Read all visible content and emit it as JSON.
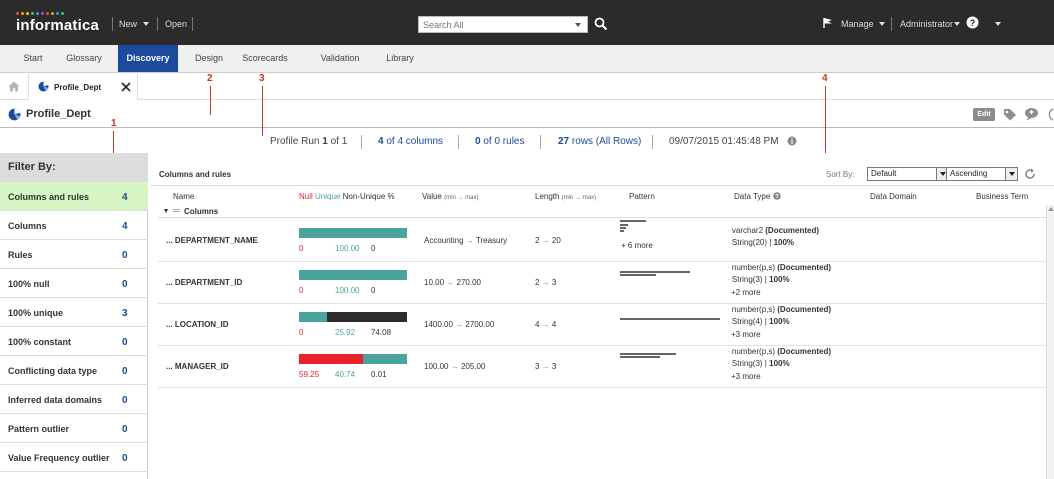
{
  "app": {
    "logo": "informatica",
    "logo_colors": [
      "#e74c3c",
      "#f39c12",
      "#f1c40f",
      "#2ecc71",
      "#3498db",
      "#9b59b6",
      "#e74c3c",
      "#f39c12",
      "#3498db",
      "#2ecc71"
    ],
    "menu_new": "New",
    "menu_open": "Open",
    "search_placeholder": "Search All",
    "manage": "Manage",
    "user": "Administrator"
  },
  "tabs": [
    {
      "label": "Start"
    },
    {
      "label": "Glossary"
    },
    {
      "label": "Discovery",
      "active": true
    },
    {
      "label": "Design"
    },
    {
      "label": "Scorecards"
    },
    {
      "label": "Validation"
    },
    {
      "label": "Library"
    }
  ],
  "doc_tab": {
    "label": "Profile_Dept"
  },
  "title": {
    "text": "Profile_Dept",
    "edit_label": "Edit"
  },
  "summary": {
    "run_prefix": "Profile Run",
    "run_num": "1",
    "run_suffix": "of 1",
    "cols_num": "4",
    "cols_suffix": "of 4 columns",
    "rules_num": "0",
    "rules_suffix": "of 0 rules",
    "rows_num": "27",
    "rows_suffix": "rows (All Rows)",
    "datetime": "09/07/2015 01:45:48 PM"
  },
  "annotations": [
    "1",
    "2",
    "3",
    "4"
  ],
  "filter": {
    "heading": "Filter By:",
    "items": [
      {
        "label": "Columns and rules",
        "count": "4",
        "active": true
      },
      {
        "label": "Columns",
        "count": "4"
      },
      {
        "label": "Rules",
        "count": "0"
      },
      {
        "label": "100% null",
        "count": "0"
      },
      {
        "label": "100% unique",
        "count": "3"
      },
      {
        "label": "100% constant",
        "count": "0"
      },
      {
        "label": "Conflicting data type",
        "count": "0"
      },
      {
        "label": "Inferred data domains",
        "count": "0"
      },
      {
        "label": "Pattern outlier",
        "count": "0"
      },
      {
        "label": "Value Frequency outlier",
        "count": "0"
      }
    ]
  },
  "main": {
    "heading": "Columns and rules",
    "sort_by_label": "Sort By:",
    "sort_value": "Default",
    "order_value": "Ascending",
    "headers": {
      "name": "Name",
      "null": "Null",
      "unique": "Unique",
      "nonunique": "Non-Unique %",
      "value": "Value",
      "value_range": "(min → max)",
      "length": "Length",
      "length_range": "(min → max)",
      "pattern": "Pattern",
      "datatype": "Data Type",
      "domain": "Data Domain",
      "term": "Business Term"
    },
    "group_label": "Columns",
    "rows": [
      {
        "name": "... DEPARTMENT_NAME",
        "null_pct": 0,
        "unique_pct": 100,
        "nonunique_pct": 0,
        "null_label": "0",
        "unique_label": "100.00",
        "nonunique_label": "0",
        "value_min": "Accounting",
        "value_max": "Treasury",
        "len_min": "2",
        "len_max": "20",
        "pattern_more": "+ 6 more",
        "dt1": "varchar2",
        "dt1_tag": "(Documented)",
        "dt2": "String(20) |",
        "dt2_pct": "100%",
        "dt_more": ""
      },
      {
        "name": "... DEPARTMENT_ID",
        "null_pct": 0,
        "unique_pct": 100,
        "nonunique_pct": 0,
        "null_label": "0",
        "unique_label": "100.00",
        "nonunique_label": "0",
        "value_min": "10.00",
        "value_max": "270.00",
        "len_min": "2",
        "len_max": "3",
        "pattern_more": "",
        "dt1": "number(p,s)",
        "dt1_tag": "(Documented)",
        "dt2": "String(3) |",
        "dt2_pct": "100%",
        "dt_more": "+2 more"
      },
      {
        "name": "... LOCATION_ID",
        "null_pct": 0,
        "unique_pct": 25.92,
        "nonunique_pct": 74.08,
        "null_label": "0",
        "unique_label": "25.92",
        "nonunique_label": "74.08",
        "value_min": "1400.00",
        "value_max": "2700.00",
        "len_min": "4",
        "len_max": "4",
        "pattern_more": "",
        "dt1": "number(p,s)",
        "dt1_tag": "(Documented)",
        "dt2": "String(4) |",
        "dt2_pct": "100%",
        "dt_more": "+3 more"
      },
      {
        "name": "... MANAGER_ID",
        "null_pct": 59.25,
        "unique_pct": 40.74,
        "nonunique_pct": 0.01,
        "null_label": "59.25",
        "unique_label": "40.74",
        "nonunique_label": "0.01",
        "value_min": "100.00",
        "value_max": "205.00",
        "len_min": "3",
        "len_max": "3",
        "pattern_more": "",
        "dt1": "number(p,s)",
        "dt1_tag": "(Documented)",
        "dt2": "String(3) |",
        "dt2_pct": "100%",
        "dt_more": "+3 more"
      }
    ]
  },
  "colors": {
    "accent": "#1a4b9c",
    "null": "#e8212b",
    "unique": "#4aa39c",
    "nonunique": "#2d2d2d",
    "filter_active": "#d7f5c2",
    "annotation": "#c0392b"
  }
}
